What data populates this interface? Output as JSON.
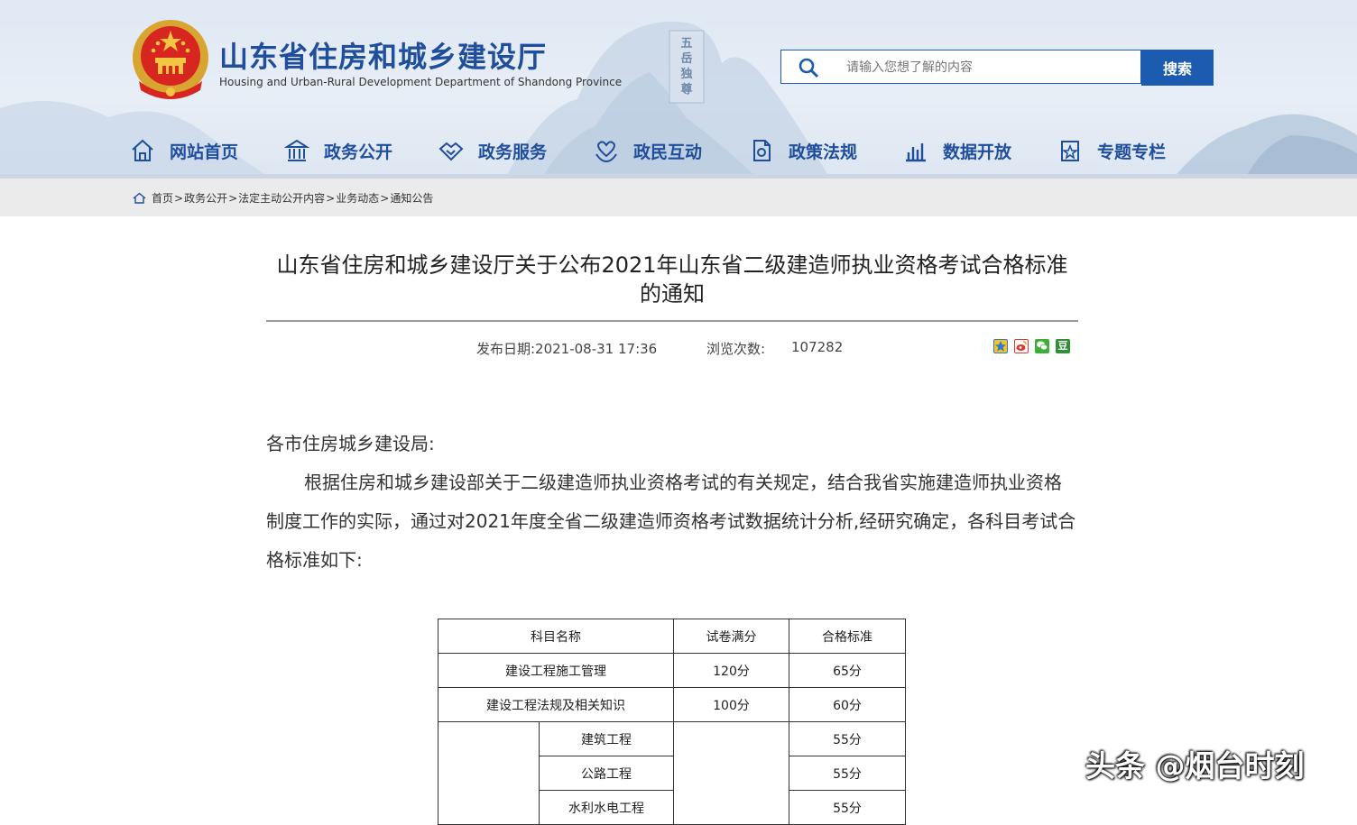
{
  "header": {
    "title": "山东省住房和城乡建设厅",
    "subtitle": "Housing and Urban-Rural Development Department of Shandong Province",
    "search_placeholder": "请输入您想了解的内容",
    "search_button": "搜索",
    "accent_color": "#1c5cb0",
    "mountain_sign": "五岳独尊"
  },
  "nav": {
    "items": [
      {
        "label": "网站首页",
        "icon": "home-icon"
      },
      {
        "label": "政务公开",
        "icon": "government-building-icon"
      },
      {
        "label": "政务服务",
        "icon": "handshake-icon"
      },
      {
        "label": "政民互动",
        "icon": "heart-hands-icon"
      },
      {
        "label": "政策法规",
        "icon": "document-icon"
      },
      {
        "label": "数据开放",
        "icon": "bar-chart-icon"
      },
      {
        "label": "专题专栏",
        "icon": "star-bookmark-icon"
      }
    ]
  },
  "breadcrumb": {
    "items": [
      "首页",
      "政务公开",
      "法定主动公开内容",
      "业务动态",
      "通知公告"
    ],
    "separator": ">"
  },
  "article": {
    "title": "山东省住房和城乡建设厅关于公布2021年山东省二级建造师执业资格考试合格标准的通知",
    "publish_date": "发布日期:2021-08-31 17:36",
    "views_label": "浏览次数:",
    "views_count": "107282",
    "share": [
      "qzone-icon",
      "weibo-icon",
      "wechat-icon",
      "douban-icon"
    ],
    "douban_glyph": "豆",
    "salutation": "各市住房城乡建设局:",
    "paragraph": "根据住房和城乡建设部关于二级建造师执业资格考试的有关规定，结合我省实施建造师执业资格制度工作的实际，通过对2021年度全省二级建造师资格考试数据统计分析,经研究确定，各科目考试合格标准如下:"
  },
  "table": {
    "headers": [
      "科目名称",
      "试卷满分",
      "合格标准"
    ],
    "rows": [
      {
        "name": "建设工程施工管理",
        "full": "120分",
        "pass": "65分"
      },
      {
        "name": "建设工程法规及相关知识",
        "full": "100分",
        "pass": "60分"
      }
    ],
    "professional_rows": [
      {
        "name": "建筑工程",
        "pass": "55分"
      },
      {
        "name": "公路工程",
        "pass": "55分"
      },
      {
        "name": "水利水电工程",
        "pass": "55分"
      }
    ]
  },
  "watermark": "头条 @烟台时刻"
}
